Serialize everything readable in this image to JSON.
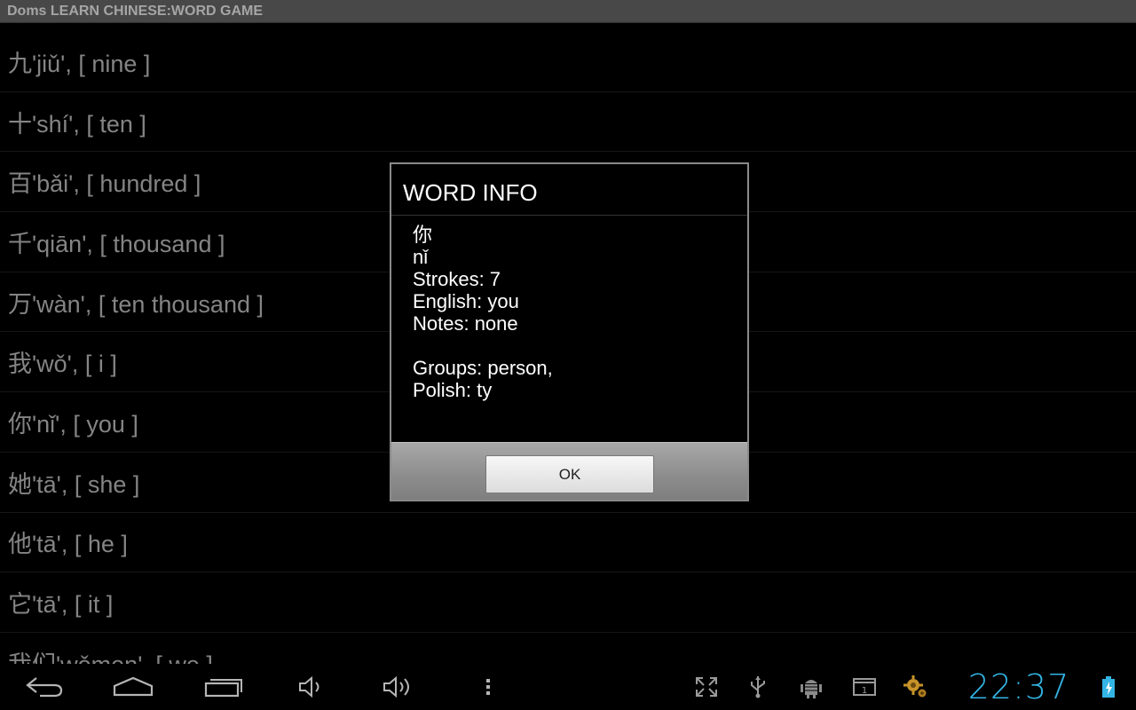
{
  "app": {
    "title": "Doms LEARN CHINESE:WORD GAME"
  },
  "word_list": [
    {
      "text": "九'jiǔ', [ nine ]"
    },
    {
      "text": "十'shí', [ ten ]"
    },
    {
      "text": "百'bǎi', [ hundred ]"
    },
    {
      "text": "千'qiān', [ thousand ]"
    },
    {
      "text": "万'wàn', [ ten thousand ]"
    },
    {
      "text": "我'wǒ', [ i ]"
    },
    {
      "text": "你'nǐ', [ you ]"
    },
    {
      "text": "她'tā', [ she ]"
    },
    {
      "text": "他'tā', [ he ]"
    },
    {
      "text": "它'tā', [ it ]"
    },
    {
      "text": "我们'wǒmen', [ we ]"
    }
  ],
  "dialog": {
    "title": "WORD INFO",
    "character": "你",
    "pinyin": "nǐ",
    "strokes": "Strokes: 7",
    "english": "English: you",
    "notes": "Notes: none",
    "groups": "Groups: person,",
    "polish": "Polish: ty",
    "ok_label": "OK"
  },
  "system_bar": {
    "clock": "22:37",
    "accent_color": "#33b5e5",
    "icons": [
      "back-icon",
      "home-icon",
      "recent-apps-icon",
      "volume-down-icon",
      "volume-up-icon",
      "menu-icon",
      "fullscreen-icon",
      "usb-icon",
      "android-debug-icon",
      "screenshot-icon",
      "settings-app-icon",
      "battery-charging-icon"
    ]
  }
}
